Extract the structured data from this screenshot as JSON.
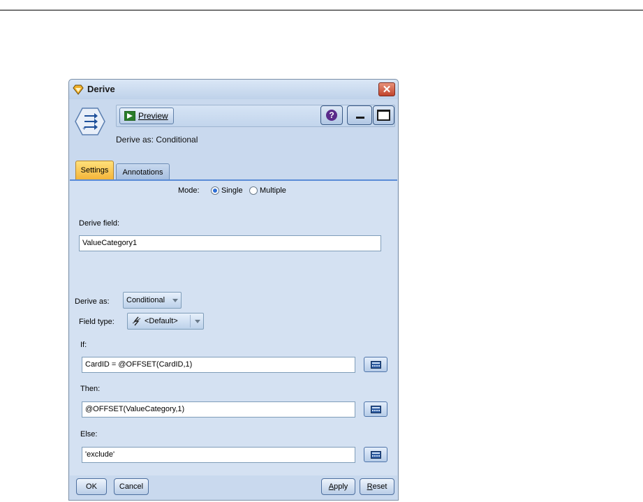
{
  "window": {
    "title": "Derive",
    "icon": "derive-node-diamond-icon"
  },
  "toolbar": {
    "preview_label": "Preview",
    "icons": [
      "preview-play-icon",
      "help-icon",
      "minimize-icon",
      "maximize-icon"
    ]
  },
  "header": {
    "derive_as_text": "Derive as: Conditional"
  },
  "tabs": [
    {
      "label": "Settings",
      "active": true
    },
    {
      "label": "Annotations",
      "active": false
    }
  ],
  "settings": {
    "mode_label": "Mode:",
    "mode_options": [
      {
        "label": "Single",
        "selected": true
      },
      {
        "label": "Multiple",
        "selected": false
      }
    ],
    "derive_field_label": "Derive field:",
    "derive_field_value": "ValueCategory1",
    "derive_as_label": "Derive as:",
    "derive_as_value": "Conditional",
    "field_type_label": "Field type:",
    "field_type_value": "<Default>",
    "if_label": "If:",
    "if_value": "CardID = @OFFSET(CardID,1)",
    "then_label": "Then:",
    "then_value": "@OFFSET(ValueCategory,1)",
    "else_label": "Else:",
    "else_value": "'exclude'"
  },
  "buttons": {
    "ok": "OK",
    "cancel": "Cancel",
    "apply": "Apply",
    "reset": "Reset"
  },
  "colors": {
    "window_bg": "#c9d9ee",
    "panel_bg": "#d4e1f2",
    "active_tab": "#f4b53a",
    "close_button": "#c1442c"
  }
}
